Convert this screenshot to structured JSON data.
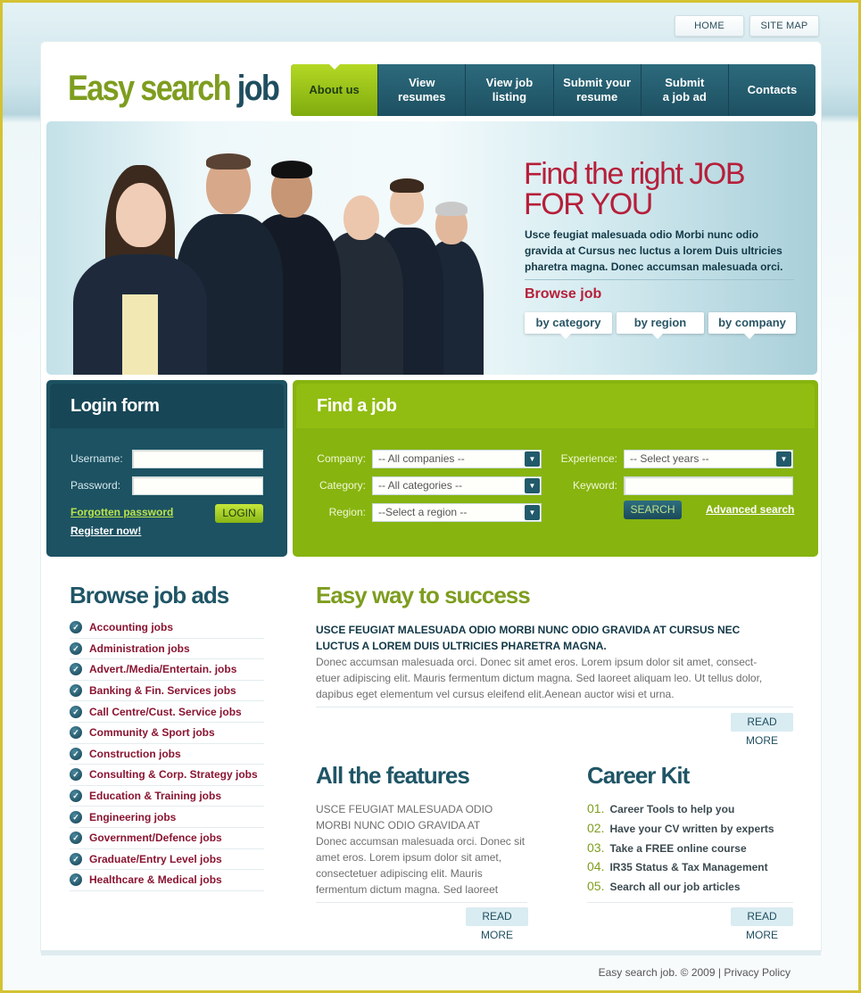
{
  "top_links": [
    "HOME",
    "SITE MAP"
  ],
  "logo": {
    "part1": "Easy search",
    "part2": "job"
  },
  "nav": [
    {
      "label": "About us",
      "active": true
    },
    {
      "label": "View\nresumes",
      "active": false
    },
    {
      "label": "View job\nlisting",
      "active": false
    },
    {
      "label": "Submit your\nresume",
      "active": false
    },
    {
      "label": "Submit\na job ad",
      "active": false
    },
    {
      "label": "Contacts",
      "active": false
    }
  ],
  "hero": {
    "title_line1": "Find the right JOB",
    "title_line2": "FOR YOU",
    "text": "Usce feugiat malesuada odio Morbi nunc odio gravida at Cursus nec luctus a lorem  Duis ultricies pharetra magna. Donec accumsan malesuada orci.",
    "browse_title": "Browse job",
    "browse_tabs": [
      "by category",
      "by region",
      "by company"
    ],
    "image_alt": "group-of-business-people-photo"
  },
  "login": {
    "title": "Login form",
    "username_label": "Username:",
    "password_label": "Password:",
    "username_value": "",
    "password_value": "",
    "forgot_label": "Forgotten password",
    "register_label": "Register now!",
    "login_button": "LOGIN"
  },
  "find_job": {
    "title": "Find a job",
    "company_label": "Company:",
    "company_value": "-- All companies --",
    "category_label": "Category:",
    "category_value": "-- All categories --",
    "region_label": "Region:",
    "region_value": "--Select a region --",
    "experience_label": "Experience:",
    "experience_value": "-- Select years --",
    "keyword_label": "Keyword:",
    "keyword_value": "",
    "search_button": "SEARCH",
    "advanced_search": "Advanced search"
  },
  "browse_ads": {
    "title": "Browse job ads",
    "items": [
      "Accounting jobs",
      "Administration jobs",
      "Advert./Media/Entertain. jobs",
      "Banking & Fin. Services jobs",
      "Call Centre/Cust. Service jobs",
      "Community & Sport jobs",
      "Construction jobs",
      "Consulting & Corp. Strategy jobs",
      "Education & Training jobs",
      "Engineering jobs",
      "Government/Defence jobs",
      "Graduate/Entry Level jobs",
      "Healthcare & Medical jobs"
    ]
  },
  "success": {
    "title": "Easy way to success",
    "bold_text": "USCE FEUGIAT MALESUADA ODIO MORBI NUNC ODIO GRAVIDA AT CURSUS NEC LUCTUS A LOREM  DUIS ULTRICIES PHARETRA MAGNA.",
    "text": "Donec accumsan malesuada orci. Donec sit amet eros. Lorem ipsum dolor sit amet, consect-etuer adipiscing elit. Mauris fermentum dictum magna. Sed laoreet aliquam leo. Ut tellus dolor, dapibus eget elementum vel cursus eleifend elit.Aenean auctor wisi et urna.",
    "read_more": "READ MORE"
  },
  "features": {
    "title": "All the features",
    "caps_text": "USCE FEUGIAT MALESUADA ODIO MORBI NUNC ODIO GRAVIDA AT",
    "text": "Donec accumsan malesuada orci. Donec sit amet eros. Lorem ipsum dolor sit amet, consectetuer adipiscing elit. Mauris fermentum dictum magna. Sed laoreet",
    "read_more": "READ MORE"
  },
  "career_kit": {
    "title": "Career Kit",
    "items": [
      {
        "num": "01.",
        "label": "Career Tools to help you"
      },
      {
        "num": "02.",
        "label": "Have your CV written by experts"
      },
      {
        "num": "03.",
        "label": "Take a FREE online course"
      },
      {
        "num": "04.",
        "label": "IR35 Status & Tax Management"
      },
      {
        "num": "05.",
        "label": "Search all our job articles"
      }
    ],
    "read_more": "READ MORE"
  },
  "footer": {
    "copyright": "Easy search job. © 2009 | ",
    "privacy": "Privacy Policy"
  },
  "colors": {
    "brand_green": "#7e9d1f",
    "brand_teal": "#1f4e5f",
    "accent_red": "#b61f3a",
    "link_maroon": "#8a1431"
  }
}
